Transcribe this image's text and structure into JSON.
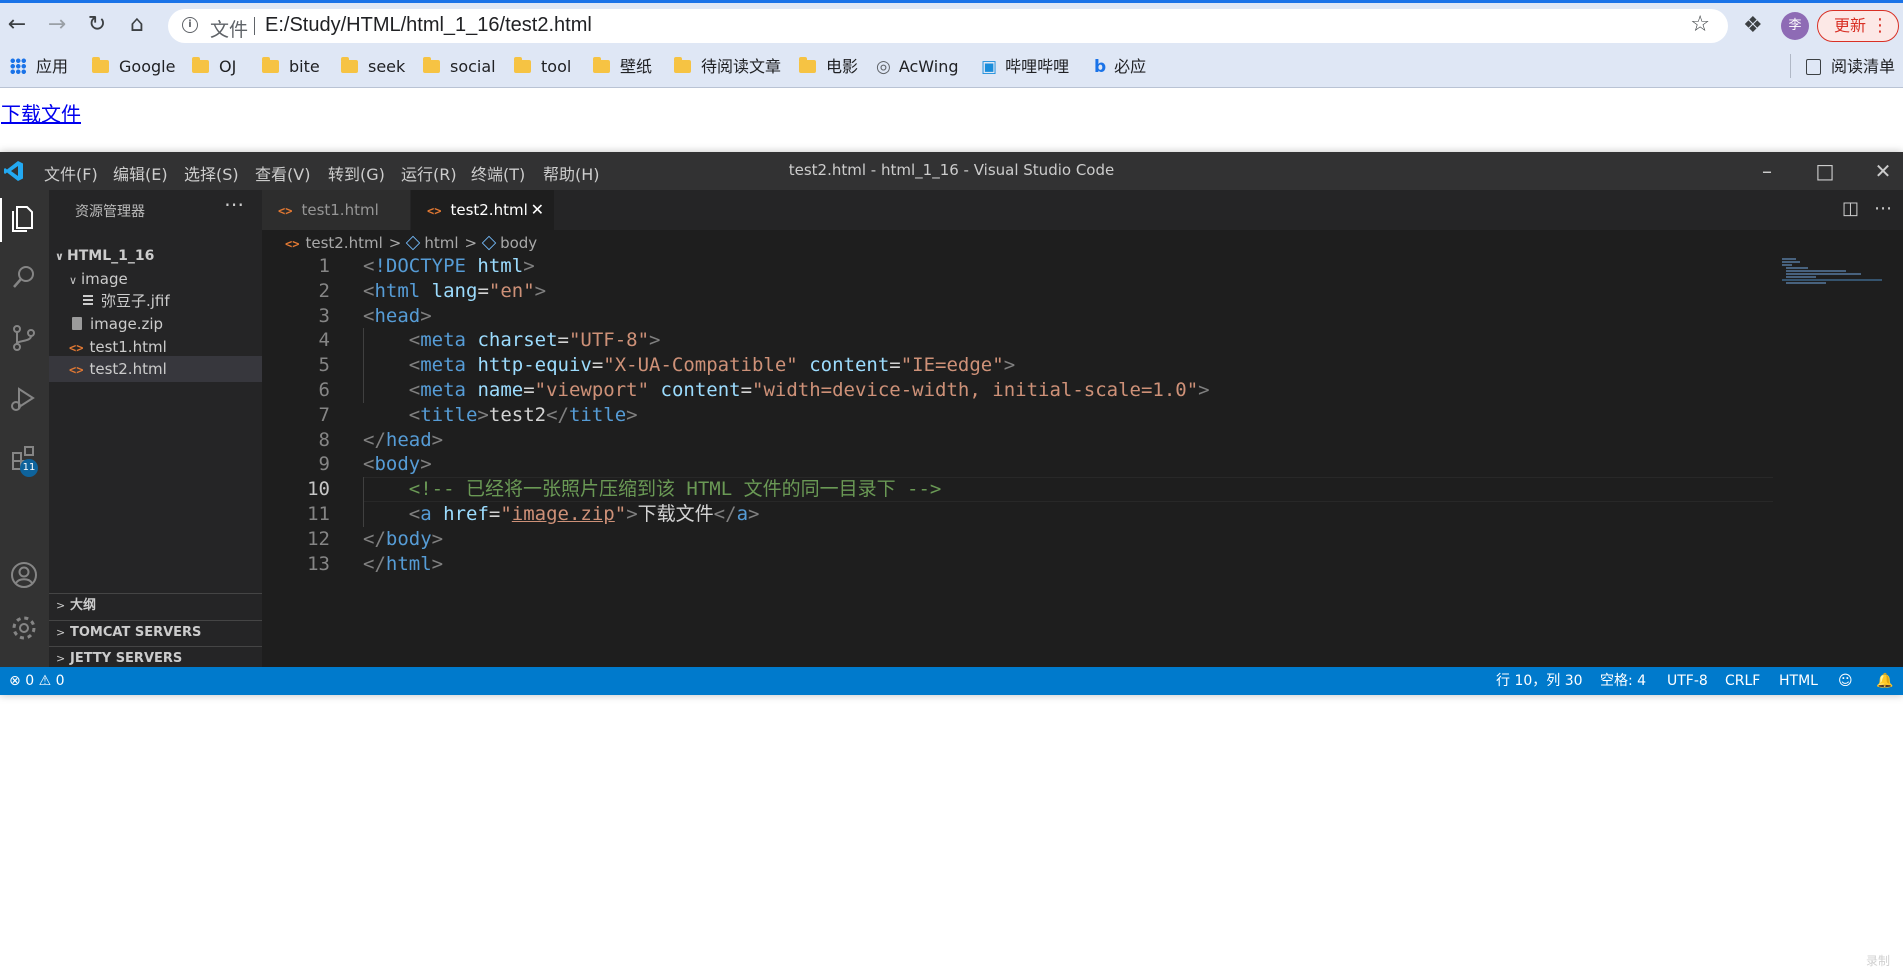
{
  "browser": {
    "address_label": "文件",
    "url": "E:/Study/HTML/html_1_16/test2.html",
    "avatar_text": "李",
    "update_label": "更新",
    "bookmarks": [
      {
        "label": "应用",
        "icon": "apps-grid-icon"
      },
      {
        "label": "Google",
        "icon": "folder-icon"
      },
      {
        "label": "OJ",
        "icon": "folder-icon"
      },
      {
        "label": "bite",
        "icon": "folder-icon"
      },
      {
        "label": "seek",
        "icon": "folder-icon"
      },
      {
        "label": "social",
        "icon": "folder-icon"
      },
      {
        "label": "tool",
        "icon": "folder-icon"
      },
      {
        "label": "壁纸",
        "icon": "folder-icon"
      },
      {
        "label": "待阅读文章",
        "icon": "folder-icon"
      },
      {
        "label": "电影",
        "icon": "folder-icon"
      },
      {
        "label": "AcWing",
        "icon": "acwing-icon"
      },
      {
        "label": "哔哩哔哩",
        "icon": "bilibili-icon"
      },
      {
        "label": "必应",
        "icon": "bing-icon"
      }
    ],
    "reading_list_label": "阅读清单"
  },
  "page": {
    "download_link": "下载文件"
  },
  "vscode": {
    "menu": [
      "文件(F)",
      "编辑(E)",
      "选择(S)",
      "查看(V)",
      "转到(G)",
      "运行(R)",
      "终端(T)",
      "帮助(H)"
    ],
    "window_title": "test2.html - html_1_16 - Visual Studio Code",
    "extensions_badge": "11",
    "explorer": {
      "title": "资源管理器",
      "folder": "HTML_1_16",
      "items": [
        "image",
        "弥豆子.jfif",
        "image.zip",
        "test1.html",
        "test2.html"
      ],
      "sections": [
        "大纲",
        "TOMCAT SERVERS",
        "JETTY SERVERS"
      ]
    },
    "tabs": [
      "test1.html",
      "test2.html"
    ],
    "breadcrumb": [
      "test2.html",
      "html",
      "body"
    ],
    "line_numbers": [
      "1",
      "2",
      "3",
      "4",
      "5",
      "6",
      "7",
      "8",
      "9",
      "10",
      "11",
      "12",
      "13"
    ],
    "code": {
      "doctype_kw": "!DOCTYPE",
      "doctype_val": "html",
      "html": "html",
      "lang_attr": "lang",
      "lang_val": "\"en\"",
      "head": "head",
      "meta": "meta",
      "charset_attr": "charset",
      "charset_val": "\"UTF-8\"",
      "httpequiv_attr": "http-equiv",
      "httpequiv_val": "\"X-UA-Compatible\"",
      "content_attr": "content",
      "content_val_ie": "\"IE=edge\"",
      "name_attr": "name",
      "name_val": "\"viewport\"",
      "content_val_vp": "\"width=device-width, initial-scale=1.0\"",
      "title": "title",
      "title_text": "test2",
      "body": "body",
      "comment": "<!-- 已经将一张照片压缩到该 HTML 文件的同一目录下 -->",
      "a": "a",
      "href_attr": "href",
      "href_q": "\"",
      "href_val": "image.zip",
      "a_text": "下载文件"
    },
    "status": {
      "errors": "0",
      "warnings": "0",
      "position": "行 10，列 30",
      "spaces": "空格: 4",
      "encoding": "UTF-8",
      "eol": "CRLF",
      "language": "HTML"
    }
  },
  "watermark": "录制"
}
